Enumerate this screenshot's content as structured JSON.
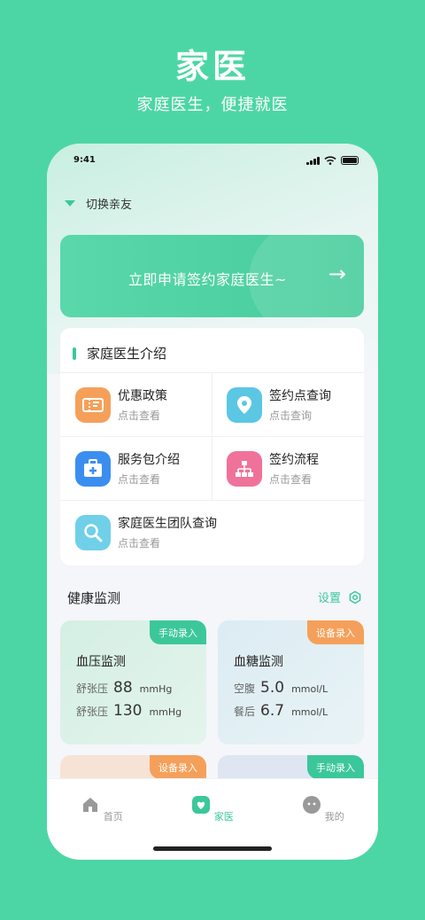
{
  "promo": {
    "title": "家医",
    "subtitle": "家庭医生，便捷就医"
  },
  "status_bar": {
    "time": "9:41"
  },
  "friend_switch": {
    "label": "切换亲友"
  },
  "banner": {
    "text": "立即申请签约家庭医生~",
    "arrow": "→"
  },
  "intro": {
    "title": "家庭医生介绍",
    "items": [
      {
        "title": "优惠政策",
        "sub": "点击查看",
        "icon": "coupon-icon",
        "color": "#f5a05a"
      },
      {
        "title": "签约点查询",
        "sub": "点击查询",
        "icon": "location-pin-icon",
        "color": "#5bc7e3"
      },
      {
        "title": "服务包介绍",
        "sub": "点击查看",
        "icon": "medical-kit-icon",
        "color": "#3b8ef0"
      },
      {
        "title": "签约流程",
        "sub": "点击查看",
        "icon": "flowchart-icon",
        "color": "#f0729a"
      },
      {
        "title": "家庭医生团队查询",
        "sub": "点击查看",
        "icon": "search-icon",
        "color": "#6fd0e8"
      }
    ]
  },
  "health": {
    "title": "健康监测",
    "settings_label": "设置",
    "cards": [
      {
        "badge": "手动录入",
        "badge_color": "#3cc79a",
        "title": "血压监测",
        "rows": [
          {
            "label": "舒张压",
            "value": "88",
            "unit": "mmHg"
          },
          {
            "label": "舒张压",
            "value": "130",
            "unit": "mmHg"
          }
        ]
      },
      {
        "badge": "设备录入",
        "badge_color": "#f5a05a",
        "title": "血糖监测",
        "rows": [
          {
            "label": "空腹",
            "value": "5.0",
            "unit": "mmol/L"
          },
          {
            "label": "餐后",
            "value": "6.7",
            "unit": "mmol/L"
          }
        ]
      },
      {
        "badge": "设备录入",
        "badge_color": "#f5a05a"
      },
      {
        "badge": "手动录入",
        "badge_color": "#3cc79a"
      }
    ]
  },
  "tabbar": {
    "items": [
      {
        "label": "首页",
        "icon": "home-icon"
      },
      {
        "label": "家医",
        "icon": "heart-icon",
        "active": true
      },
      {
        "label": "我的",
        "icon": "profile-icon"
      }
    ]
  }
}
